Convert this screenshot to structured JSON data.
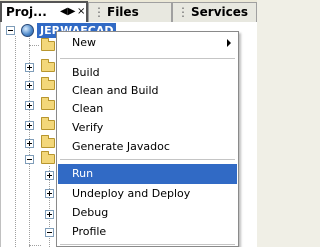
{
  "tabs": [
    {
      "label": "Proj..."
    },
    {
      "label": "Files"
    },
    {
      "label": "Services"
    }
  ],
  "tab_controls": {
    "pin_symbol": "◀▶",
    "close_symbol": "×"
  },
  "tree": {
    "root_label": "JERWAFCAD"
  },
  "context_menu": {
    "items": [
      {
        "label": "New"
      },
      {
        "label": "Build"
      },
      {
        "label": "Clean and Build"
      },
      {
        "label": "Clean"
      },
      {
        "label": "Verify"
      },
      {
        "label": "Generate Javadoc"
      },
      {
        "label": "Run"
      },
      {
        "label": "Undeploy and Deploy"
      },
      {
        "label": "Debug"
      },
      {
        "label": "Profile"
      }
    ],
    "selected": "Run"
  },
  "colors": {
    "selection": "#316ac5",
    "folder": "#f3d77a",
    "tab_strip": "#ece9d8"
  }
}
